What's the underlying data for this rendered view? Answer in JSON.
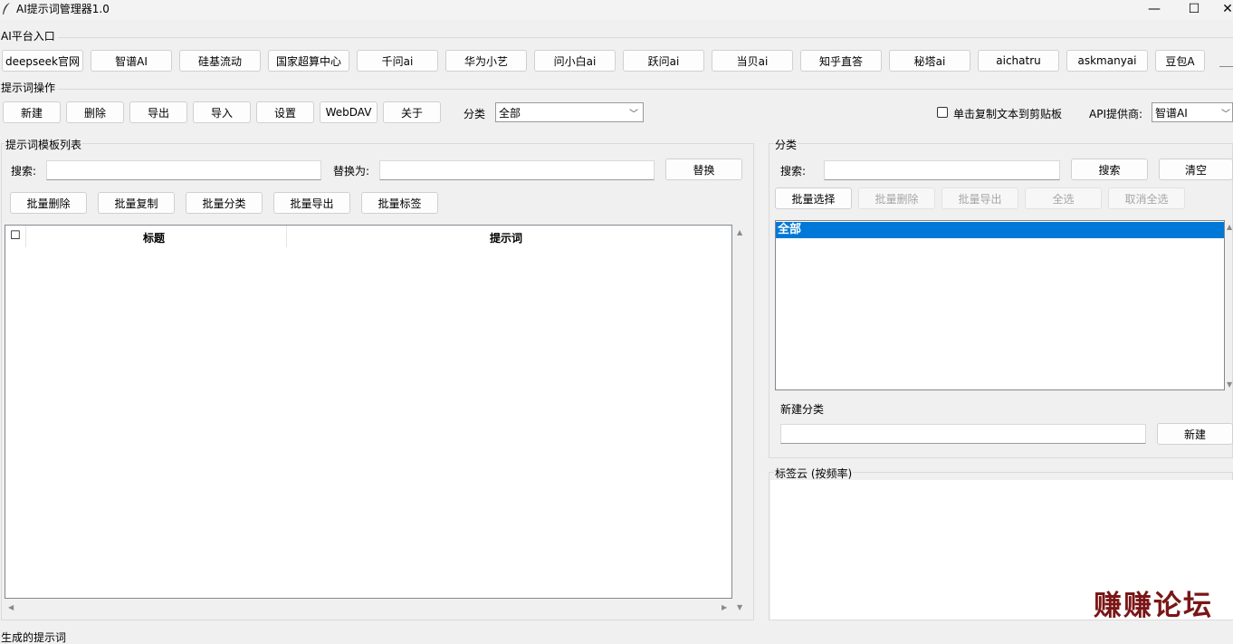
{
  "window": {
    "title": "AI提示词管理器1.0",
    "minimize_glyph": "—",
    "maximize_glyph": "☐",
    "close_glyph": "✕"
  },
  "platform": {
    "label": "AI平台入口",
    "buttons": [
      "deepseek官网",
      "智谱AI",
      "硅基流动",
      "国家超算中心",
      "千问ai",
      "华为小艺",
      "问小白ai",
      "跃问ai",
      "当贝ai",
      "知乎直答",
      "秘塔ai",
      "aichatru",
      "askmanyai",
      "豆包A"
    ]
  },
  "ops": {
    "label": "提示词操作",
    "buttons": [
      "新建",
      "删除",
      "导出",
      "导入",
      "设置",
      "WebDAV",
      "关于"
    ],
    "category_label": "分类",
    "category_value": "全部",
    "copy_checkbox_label": "单击复制文本到剪贴板",
    "api_label": "API提供商:",
    "api_value": "智谱AI"
  },
  "template_list": {
    "label": "提示词模板列表",
    "search_label": "搜索:",
    "replace_label": "替换为:",
    "replace_button": "替换",
    "batch_buttons": [
      "批量删除",
      "批量复制",
      "批量分类",
      "批量导出",
      "批量标签"
    ],
    "columns": [
      "标题",
      "提示词"
    ],
    "check_glyph": "☐"
  },
  "category_panel": {
    "label": "分类",
    "search_label": "搜索:",
    "search_button": "搜索",
    "clear_button": "清空",
    "batch_buttons": [
      "批量选择",
      "批量删除",
      "批量导出",
      "全选",
      "取消全选"
    ],
    "items": [
      "全部"
    ],
    "new_label": "新建分类",
    "new_button": "新建"
  },
  "tag_cloud": {
    "label": "标签云 (按频率)"
  },
  "bottom_label": "生成的提示词",
  "watermark": "赚赚论坛",
  "icons": [
    "feather-icon",
    "dropdown-arrow-icon",
    "scroll-up-arrow-icon",
    "scroll-down-arrow-icon",
    "scroll-left-arrow-icon",
    "scroll-right-arrow-icon"
  ]
}
